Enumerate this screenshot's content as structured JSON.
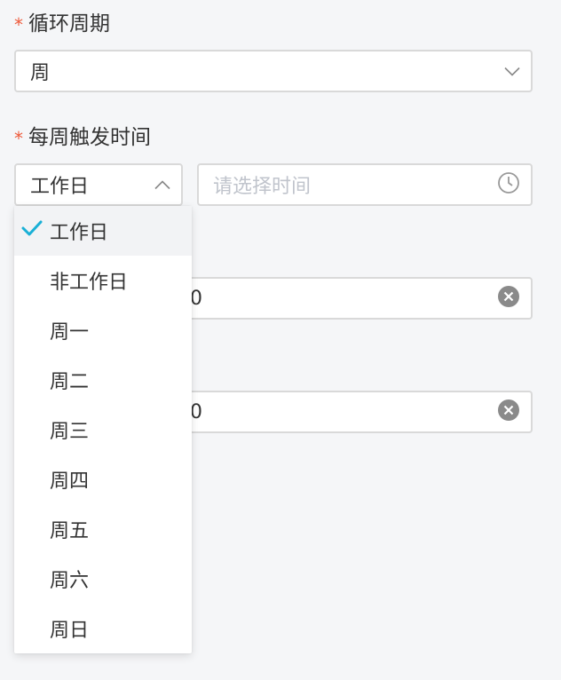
{
  "cycle_field": {
    "required_mark": "*",
    "label": "循环周期",
    "value": "周",
    "icon": "chevron-down-icon"
  },
  "trigger_field": {
    "required_mark": "*",
    "label": "每周触发时间",
    "day_select": {
      "value": "工作日",
      "icon": "chevron-up-icon"
    },
    "time_input": {
      "placeholder": "请选择时间",
      "icon": "clock-icon"
    }
  },
  "hidden_fields": [
    {
      "visible_value": "0",
      "icon": "clear-circle-icon"
    },
    {
      "visible_value": "0",
      "icon": "clear-circle-icon"
    }
  ],
  "day_dropdown": {
    "selected_index": 0,
    "options": [
      {
        "label": "工作日",
        "selected": true
      },
      {
        "label": "非工作日",
        "selected": false
      },
      {
        "label": "周一",
        "selected": false
      },
      {
        "label": "周二",
        "selected": false
      },
      {
        "label": "周三",
        "selected": false
      },
      {
        "label": "周四",
        "selected": false
      },
      {
        "label": "周五",
        "selected": false
      },
      {
        "label": "周六",
        "selected": false
      },
      {
        "label": "周日",
        "selected": false
      }
    ]
  },
  "colors": {
    "required": "#ee5a3a",
    "check": "#1ab0d6",
    "border": "#d9d9d9",
    "placeholder": "#c0c4cc",
    "background": "#f5f6f8"
  }
}
